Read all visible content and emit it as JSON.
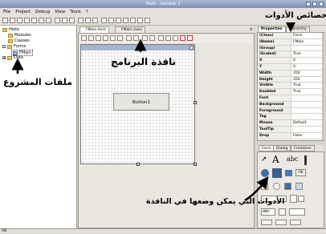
{
  "window": {
    "title": "Hello - Gambas 3"
  },
  "menu": [
    "File",
    "Project",
    "Debug",
    "View",
    "Tools",
    "?"
  ],
  "project_tree": {
    "root": "Hello",
    "items": [
      "Modules",
      "Classes",
      "Forms",
      "FMain",
      "Data"
    ]
  },
  "editor": {
    "tabs": [
      "FMain.form",
      "FMain.class"
    ],
    "form_button_label": "Button1"
  },
  "properties": {
    "tabs": [
      "Properties",
      "Hierarchy"
    ],
    "rows": [
      [
        "(Class)",
        "Form"
      ],
      [
        "(Name)",
        "FMain"
      ],
      [
        "(Group)",
        ""
      ],
      [
        "(Scaled)",
        "True"
      ],
      [
        "X",
        "0"
      ],
      [
        "Y",
        "0"
      ],
      [
        "Width",
        "350"
      ],
      [
        "Height",
        "350"
      ],
      [
        "Visible",
        "True"
      ],
      [
        "Enabled",
        "True"
      ],
      [
        "Font",
        ""
      ],
      [
        "Background",
        ""
      ],
      [
        "Foreground",
        ""
      ],
      [
        "Tag",
        ""
      ],
      [
        "Mouse",
        "Default"
      ],
      [
        "ToolTip",
        ""
      ],
      [
        "Drop",
        "False"
      ]
    ]
  },
  "toolbox": {
    "tabs": [
      "Form",
      "Dialog",
      "Container"
    ],
    "label_text": "abc",
    "textbox_text": "abc",
    "ok_label": "OK"
  },
  "status": {
    "text": "OK"
  },
  "annotations": {
    "properties": "خصائص الأدوات",
    "window": "نافذة البرنامج",
    "project": "ملفات المشروع",
    "tools": "الأدوات التي يمكن وضعها في النافذة"
  }
}
